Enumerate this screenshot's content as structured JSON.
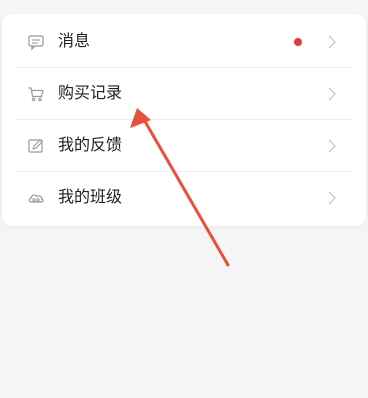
{
  "menu": {
    "items": [
      {
        "id": "messages",
        "label": "消息",
        "icon": "message-icon",
        "has_badge": true
      },
      {
        "id": "purchases",
        "label": "购买记录",
        "icon": "cart-icon",
        "has_badge": false
      },
      {
        "id": "feedback",
        "label": "我的反馈",
        "icon": "edit-icon",
        "has_badge": false
      },
      {
        "id": "classes",
        "label": "我的班级",
        "icon": "cloud-group-icon",
        "has_badge": false
      }
    ]
  },
  "colors": {
    "background": "#f5f5f5",
    "card": "#ffffff",
    "badge": "#e53935",
    "annotation_arrow": "#e8503a",
    "icon": "#9a9a9a",
    "chevron": "#c8c8c8",
    "text": "#222222"
  }
}
